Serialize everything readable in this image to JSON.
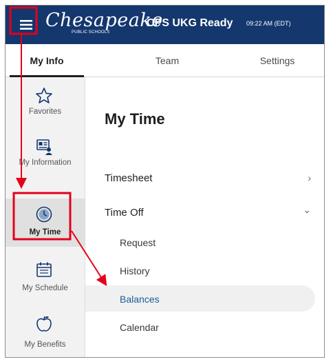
{
  "header": {
    "logo_script": "Chesapeake",
    "logo_sub": "PUBLIC SCHOOLS",
    "app_title": "CPS UKG Ready",
    "clock": "09:22 AM (EDT)"
  },
  "tabs": [
    {
      "label": "My Info",
      "active": true
    },
    {
      "label": "Team",
      "active": false
    },
    {
      "label": "Settings",
      "active": false
    }
  ],
  "sidebar": {
    "items": [
      {
        "label": "Favorites",
        "icon": "star-icon"
      },
      {
        "label": "My Information",
        "icon": "id-card-icon"
      },
      {
        "label": "My Time",
        "icon": "clock-icon",
        "active": true
      },
      {
        "label": "My Schedule",
        "icon": "calendar-icon"
      },
      {
        "label": "My Benefits",
        "icon": "apple-icon"
      }
    ]
  },
  "main": {
    "title": "My Time",
    "menu": [
      {
        "label": "Timesheet",
        "chevron": "›"
      },
      {
        "label": "Time Off",
        "chevron": "⌄"
      }
    ],
    "time_off_items": [
      {
        "label": "Request"
      },
      {
        "label": "History"
      },
      {
        "label": "Balances",
        "selected": true
      },
      {
        "label": "Calendar"
      }
    ]
  },
  "annotation": {
    "color": "#e3001b"
  },
  "colors": {
    "header_bg": "#14376e",
    "link_blue": "#1a5b96"
  }
}
